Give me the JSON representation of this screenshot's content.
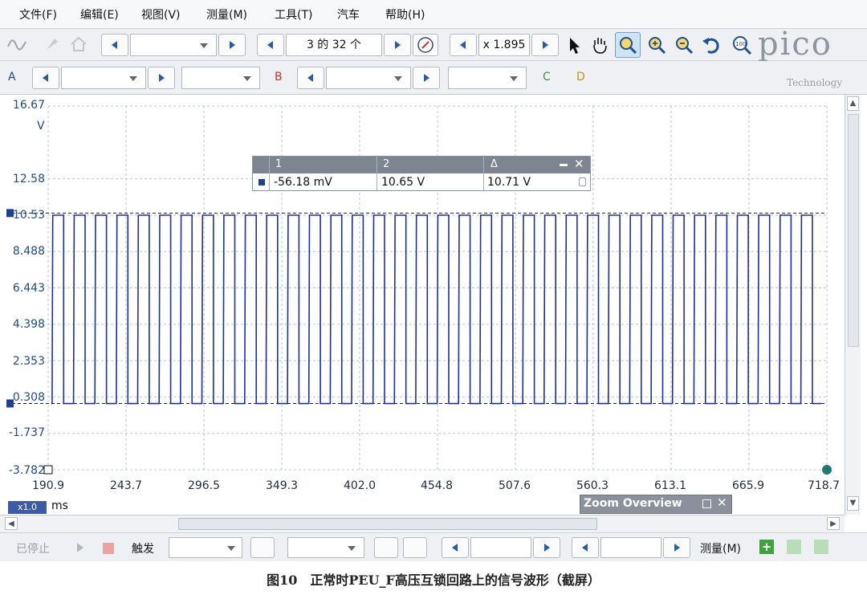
{
  "menu": {
    "file": "文件(F)",
    "edit": "编辑(E)",
    "view": "视图(V)",
    "measure": "测量(M)",
    "tools": "工具(T)",
    "auto": "汽车",
    "help": "帮助(H)"
  },
  "toolbar": {
    "capture_counter": "3 的 32 个",
    "zoom_factor": "x 1.895",
    "brand": "pico",
    "brand_sub": "Technology",
    "channel_a": "A",
    "channel_b": "B",
    "channel_c": "C",
    "channel_d": "D"
  },
  "ruler_panel": {
    "headers": [
      "1",
      "2",
      "Δ"
    ],
    "values": [
      "-56.18 mV",
      "10.65 V",
      "10.71 V"
    ]
  },
  "axes": {
    "y_unit": "V",
    "y_ticks": [
      "16.67",
      "12.58",
      "10.53",
      "8.488",
      "6.443",
      "4.398",
      "2.353",
      "0.308",
      "-1.737",
      "-3.782"
    ],
    "x_ticks": [
      "190.9",
      "243.7",
      "296.5",
      "349.3",
      "402.0",
      "454.8",
      "507.6",
      "560.3",
      "613.1",
      "665.9",
      "718.7"
    ],
    "x_unit": "ms",
    "x_scale": "x1.0"
  },
  "zoom_overview": {
    "title": "Zoom Overview"
  },
  "statusbar": {
    "stopped": "已停止",
    "trigger": "触发",
    "measurements": "测量(M)"
  },
  "caption": "图10　正常时PEU_F高压互锁回路上的信号波形（截屏）",
  "colors": {
    "trace": "#1f2f9a",
    "grid": "#b9c6d6",
    "axis_text": "#1e4a8e"
  },
  "chart_data": {
    "type": "line",
    "xlabel": "ms",
    "ylabel": "V",
    "xlim": [
      190.9,
      718.7
    ],
    "ylim": [
      -3.782,
      16.67
    ],
    "x_ticks": [
      190.9,
      243.7,
      296.5,
      349.3,
      402.0,
      454.8,
      507.6,
      560.3,
      613.1,
      665.9,
      718.7
    ],
    "y_ticks": [
      16.67,
      12.58,
      10.53,
      8.488,
      6.443,
      4.398,
      2.353,
      0.308,
      -1.737,
      -3.782
    ],
    "grid": true,
    "series": [
      {
        "signal": "square",
        "high": 10.53,
        "low": -0.06,
        "start": 193.0,
        "end": 715.0,
        "cycles": 36
      }
    ],
    "rulers": {
      "ruler_1": -0.05618,
      "ruler_2": 10.65,
      "delta": 10.71
    }
  }
}
